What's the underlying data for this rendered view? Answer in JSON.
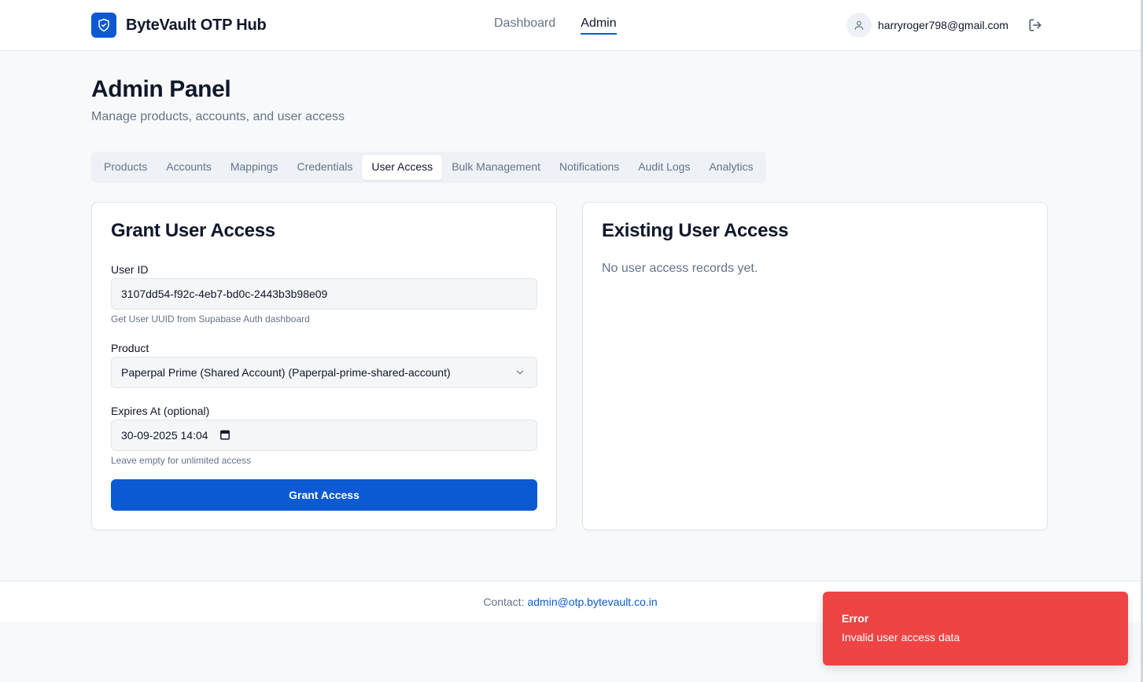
{
  "header": {
    "app_name": "ByteVault OTP Hub",
    "nav": [
      {
        "label": "Dashboard",
        "active": false
      },
      {
        "label": "Admin",
        "active": true
      }
    ],
    "user_email": "harryroger798@gmail.com"
  },
  "page": {
    "title": "Admin Panel",
    "subtitle": "Manage products, accounts, and user access"
  },
  "tabs": [
    {
      "label": "Products",
      "active": false
    },
    {
      "label": "Accounts",
      "active": false
    },
    {
      "label": "Mappings",
      "active": false
    },
    {
      "label": "Credentials",
      "active": false
    },
    {
      "label": "User Access",
      "active": true
    },
    {
      "label": "Bulk Management",
      "active": false
    },
    {
      "label": "Notifications",
      "active": false
    },
    {
      "label": "Audit Logs",
      "active": false
    },
    {
      "label": "Analytics",
      "active": false
    }
  ],
  "grant": {
    "title": "Grant User Access",
    "user_id_label": "User ID",
    "user_id_value": "3107dd54-f92c-4eb7-bd0c-2443b3b98e09",
    "user_id_hint": "Get User UUID from Supabase Auth dashboard",
    "product_label": "Product",
    "product_value": "Paperpal Prime (Shared Account) (Paperpal-prime-shared-account)",
    "expires_label": "Expires At (optional)",
    "expires_value": "30-09-2025 14:04",
    "expires_hint": "Leave empty for unlimited access",
    "button_label": "Grant Access"
  },
  "existing": {
    "title": "Existing User Access",
    "empty_text": "No user access records yet."
  },
  "footer": {
    "contact_label": "Contact:",
    "contact_email": "admin@otp.bytevault.co.in"
  },
  "toast": {
    "title": "Error",
    "message": "Invalid user access data"
  },
  "colors": {
    "accent": "#0b5ad3",
    "error": "#ef4444"
  }
}
